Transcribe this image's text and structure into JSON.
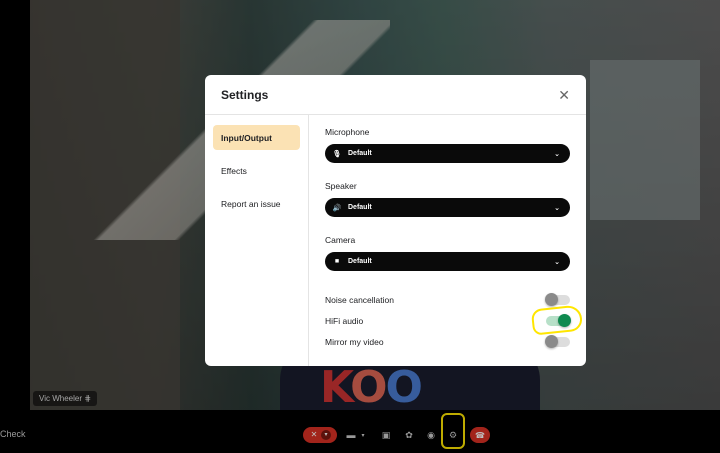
{
  "video": {
    "participant_name": "Vic Wheeler",
    "shirt_text": [
      "K",
      "O",
      "O"
    ]
  },
  "bottom_bar": {
    "left_label": "Check",
    "icons": {
      "mic": "mic-off-icon",
      "camera": "camera-icon",
      "chat": "chat-icon",
      "effects": "effects-icon",
      "record": "record-icon",
      "settings": "gear-icon",
      "hangup": "hangup-icon"
    },
    "colors": {
      "mic_muted": "#d93025",
      "hangup": "#d93025",
      "highlight": "#ffe600"
    }
  },
  "settings": {
    "title": "Settings",
    "nav": [
      {
        "label": "Input/Output",
        "active": true
      },
      {
        "label": "Effects",
        "active": false
      },
      {
        "label": "Report an issue",
        "active": false
      }
    ],
    "microphone": {
      "label": "Microphone",
      "value": "Default"
    },
    "speaker": {
      "label": "Speaker",
      "value": "Default"
    },
    "camera": {
      "label": "Camera",
      "value": "Default"
    },
    "toggles": [
      {
        "label": "Noise cancellation",
        "on": false
      },
      {
        "label": "HiFi audio",
        "on": true
      },
      {
        "label": "Mirror my video",
        "on": false
      }
    ],
    "colors": {
      "nav_active": "#fbe2b4",
      "toggle_on": "#0f8a4f",
      "dropdown_bg": "#0a0a0a"
    }
  }
}
